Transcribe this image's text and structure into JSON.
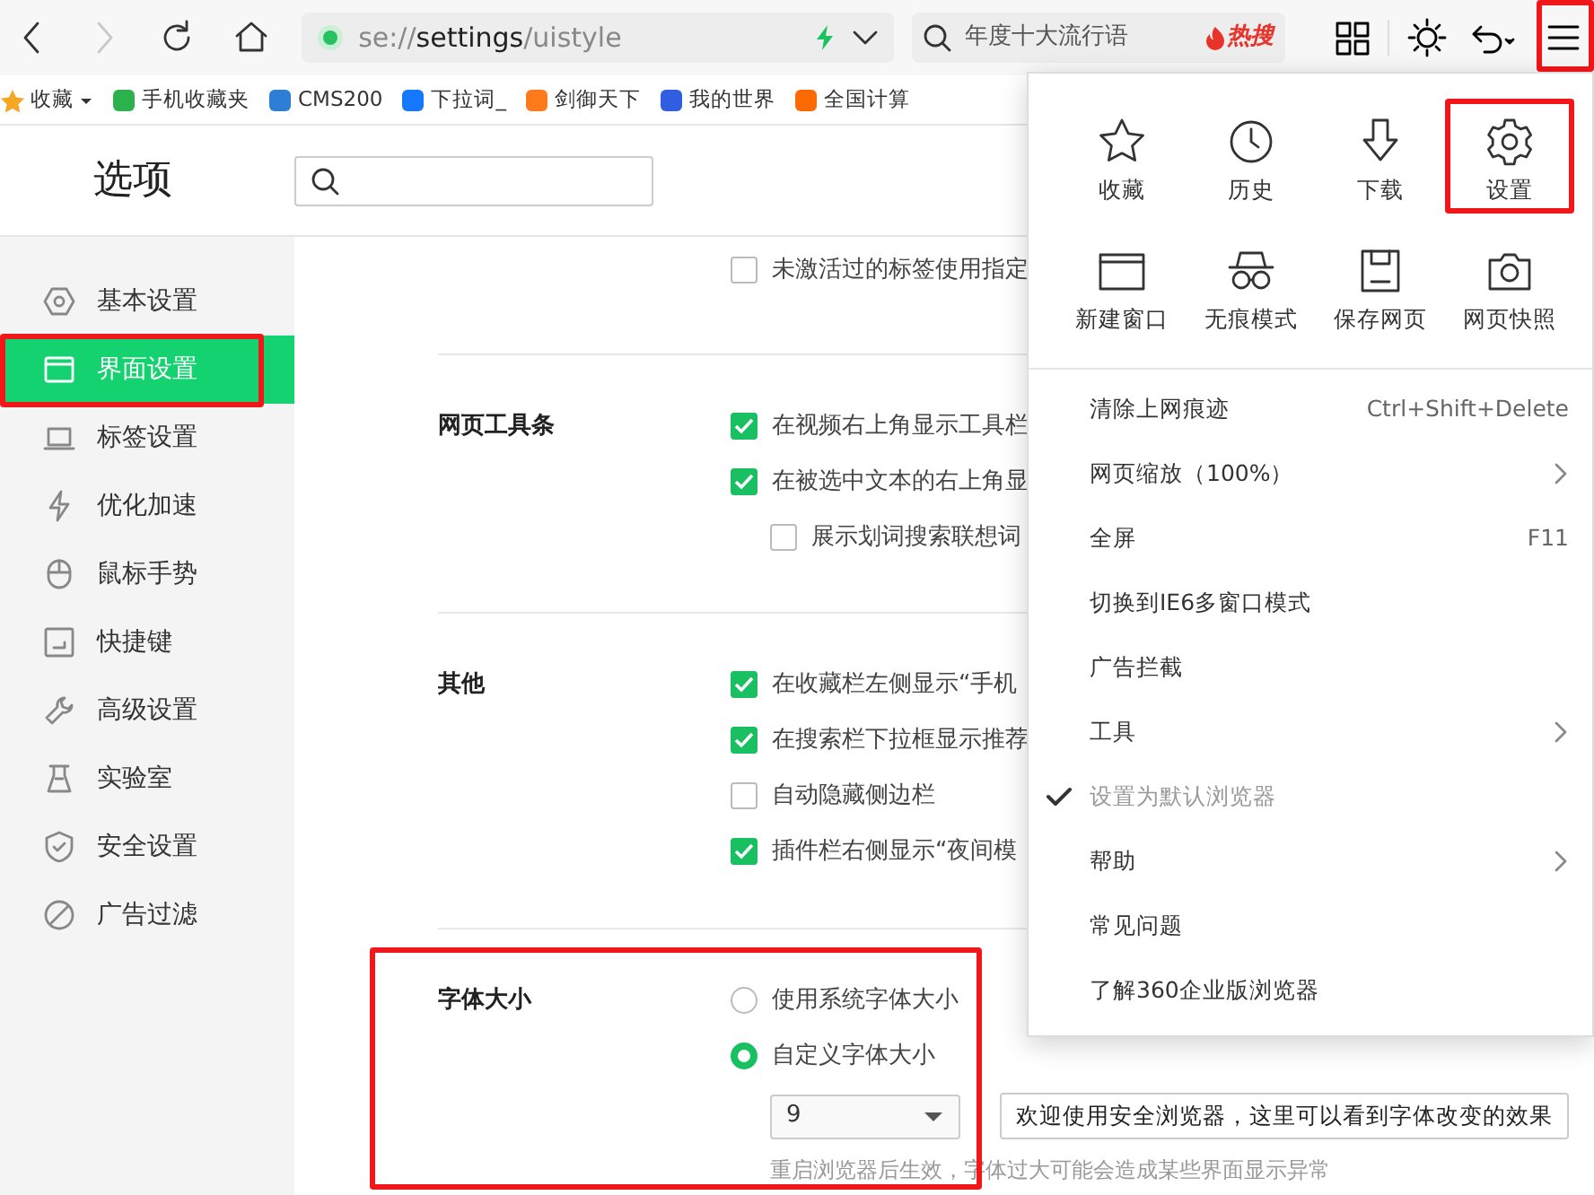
{
  "toolbar": {
    "nav": [
      {
        "kind": "back",
        "disabled": false
      },
      {
        "kind": "forward",
        "disabled": true
      },
      {
        "kind": "reload",
        "disabled": false
      },
      {
        "kind": "home",
        "disabled": false
      }
    ],
    "address": "se://**settings**/uistyle",
    "search": {
      "placeholder": "年度十大流行语",
      "hot_label": "热搜"
    },
    "menu_button": {
      "highlighted": true
    }
  },
  "bookmarks": [
    {
      "label": "收藏",
      "color": "#f5a623",
      "dropdown": true
    },
    {
      "label": "手机收藏夹",
      "color": "#2bb24c",
      "dropdown": false
    },
    {
      "label": "CMS200",
      "color": "#2d7fd6",
      "dropdown": false
    },
    {
      "label": "下拉词_",
      "color": "#1677ff",
      "dropdown": false
    },
    {
      "label": "剑御天下",
      "color": "#ff7a1a",
      "dropdown": false
    },
    {
      "label": "我的世界",
      "color": "#2f5fe0",
      "dropdown": false
    },
    {
      "label": "全国计算",
      "color": "#ff6a00",
      "dropdown": false
    }
  ],
  "page": {
    "title": "选项"
  },
  "sidebar": [
    {
      "label": "基本设置",
      "selected": false,
      "highlighted": false
    },
    {
      "label": "界面设置",
      "selected": true,
      "highlighted": true
    },
    {
      "label": "标签设置",
      "selected": false,
      "highlighted": false
    },
    {
      "label": "优化加速",
      "selected": false,
      "highlighted": false
    },
    {
      "label": "鼠标手势",
      "selected": false,
      "highlighted": false
    },
    {
      "label": "快捷键",
      "selected": false,
      "highlighted": false
    },
    {
      "label": "高级设置",
      "selected": false,
      "highlighted": false
    },
    {
      "label": "实验室",
      "selected": false,
      "highlighted": false
    },
    {
      "label": "安全设置",
      "selected": false,
      "highlighted": false
    },
    {
      "label": "广告过滤",
      "selected": false,
      "highlighted": false
    }
  ],
  "sections": [
    {
      "highlighted": false,
      "options": [
        {
          "kind": "checkbox",
          "label": "未激活过的标签使用指定",
          "checked": false
        }
      ]
    },
    {
      "title": "网页工具条",
      "highlighted": false,
      "options": [
        {
          "kind": "checkbox",
          "label": "在视频右上角显示工具栏",
          "checked": true
        },
        {
          "kind": "checkbox",
          "label": "在被选中文本的右上角显",
          "checked": true,
          "children": [
            {
              "kind": "checkbox",
              "label": "展示划词搜索联想词",
              "checked": false
            }
          ]
        }
      ]
    },
    {
      "title": "其他",
      "highlighted": false,
      "options": [
        {
          "kind": "checkbox",
          "label": "在收藏栏左侧显示“手机",
          "checked": true
        },
        {
          "kind": "checkbox",
          "label": "在搜索栏下拉框显示推荐",
          "checked": true
        },
        {
          "kind": "checkbox",
          "label": "自动隐藏侧边栏",
          "checked": false
        },
        {
          "kind": "checkbox",
          "label": "插件栏右侧显示“夜间模",
          "checked": true
        }
      ]
    },
    {
      "title": "字体大小",
      "highlighted": true,
      "options": [
        {
          "kind": "radio",
          "label": "使用系统字体大小",
          "selected": false
        },
        {
          "kind": "radio",
          "label": "自定义字体大小",
          "selected": true
        },
        {
          "kind": "font-size",
          "value": "9",
          "preview": "欢迎使用安全浏览器，这里可以看到字体改变的效果"
        },
        {
          "kind": "hint",
          "label": "重启浏览器后生效，字体过大可能会造成某些界面显示异常"
        }
      ]
    }
  ],
  "menu": {
    "grid": [
      {
        "label": "收藏",
        "highlighted": false
      },
      {
        "label": "历史",
        "highlighted": false
      },
      {
        "label": "下载",
        "highlighted": false
      },
      {
        "label": "设置",
        "highlighted": true
      },
      {
        "label": "新建窗口",
        "highlighted": false
      },
      {
        "label": "无痕模式",
        "highlighted": false
      },
      {
        "label": "保存网页",
        "highlighted": false
      },
      {
        "label": "网页快照",
        "highlighted": false
      }
    ],
    "items": [
      {
        "label": "清除上网痕迹",
        "shortcut": "Ctrl+Shift+Delete",
        "submenu": false,
        "checked": false,
        "disabled": false
      },
      {
        "label": "网页缩放（100%）",
        "submenu": true,
        "checked": false,
        "disabled": false
      },
      {
        "label": "全屏",
        "shortcut": "F11",
        "submenu": false,
        "checked": false,
        "disabled": false
      },
      {
        "label": "切换到IE6多窗口模式",
        "submenu": false,
        "checked": false,
        "disabled": false
      },
      {
        "label": "广告拦截",
        "submenu": false,
        "checked": false,
        "disabled": false
      },
      {
        "label": "工具",
        "submenu": true,
        "checked": false,
        "disabled": false
      },
      {
        "label": "设置为默认浏览器",
        "submenu": false,
        "checked": true,
        "disabled": true
      },
      {
        "label": "帮助",
        "submenu": true,
        "checked": false,
        "disabled": false
      },
      {
        "label": "常见问题",
        "submenu": false,
        "checked": false,
        "disabled": false
      },
      {
        "label": "了解360企业版浏览器",
        "submenu": false,
        "checked": false,
        "disabled": false
      }
    ]
  }
}
